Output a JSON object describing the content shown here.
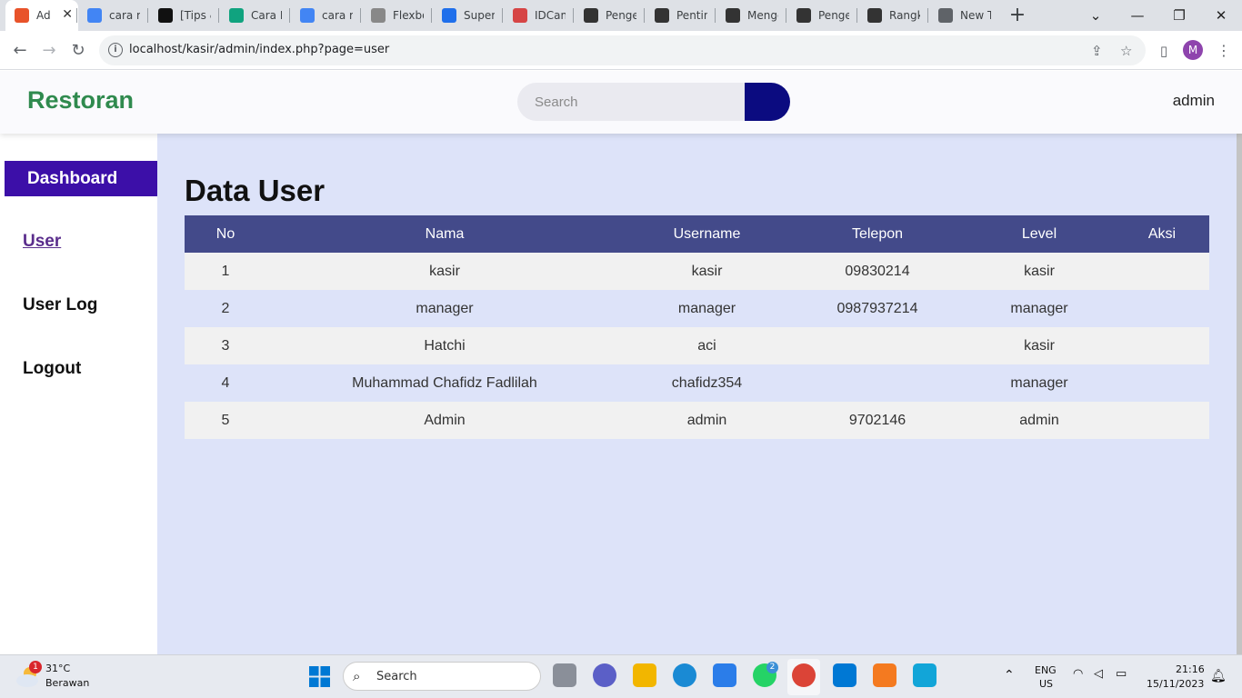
{
  "browser": {
    "tabs": [
      {
        "label": "Ad",
        "active": true,
        "favicon": "xampp-icon",
        "color": "#e8532a"
      },
      {
        "label": "cara m",
        "favicon": "google-icon",
        "color": "#4285f4"
      },
      {
        "label": "[Tips &",
        "favicon": "medium-icon",
        "color": "#111111"
      },
      {
        "label": "Cara M",
        "favicon": "chatgpt-icon",
        "color": "#10a37f"
      },
      {
        "label": "cara m",
        "favicon": "google-icon",
        "color": "#4285f4"
      },
      {
        "label": "Flexbo",
        "favicon": "css-tricks-icon",
        "color": "#888888"
      },
      {
        "label": "Super s",
        "favicon": "code-icon",
        "color": "#1f6feb"
      },
      {
        "label": "IDCam",
        "favicon": "idcamp-icon",
        "color": "#d64545"
      },
      {
        "label": "Penger",
        "favicon": "g-icon",
        "color": "#333333"
      },
      {
        "label": "Penting",
        "favicon": "g-icon",
        "color": "#333333"
      },
      {
        "label": "Menge",
        "favicon": "g-icon",
        "color": "#333333"
      },
      {
        "label": "Penger",
        "favicon": "g-icon",
        "color": "#333333"
      },
      {
        "label": "Rangki",
        "favicon": "g-icon",
        "color": "#333333"
      },
      {
        "label": "New Ta",
        "favicon": "chrome-icon",
        "color": "#5f6368"
      }
    ],
    "url": "localhost/kasir/admin/index.php?page=user",
    "profile_initial": "M"
  },
  "header": {
    "brand": "Restoran",
    "search_placeholder": "Search",
    "user": "admin"
  },
  "sidebar": {
    "dashboard": "Dashboard",
    "items": [
      {
        "label": "User",
        "active": true
      },
      {
        "label": "User Log",
        "active": false
      },
      {
        "label": "Logout",
        "active": false
      }
    ]
  },
  "main": {
    "title": "Data User",
    "columns": [
      "No",
      "Nama",
      "Username",
      "Telepon",
      "Level",
      "Aksi"
    ],
    "rows": [
      [
        "1",
        "kasir",
        "kasir",
        "09830214",
        "kasir",
        ""
      ],
      [
        "2",
        "manager",
        "manager",
        "0987937214",
        "manager",
        ""
      ],
      [
        "3",
        "Hatchi",
        "aci",
        "",
        "kasir",
        ""
      ],
      [
        "4",
        "Muhammad Chafidz Fadlilah",
        "chafidz354",
        "",
        "manager",
        ""
      ],
      [
        "5",
        "Admin",
        "admin",
        "9702146",
        "admin",
        ""
      ]
    ]
  },
  "taskbar": {
    "weather_temp": "31°C",
    "weather_desc": "Berawan",
    "weather_badge": "1",
    "search_label": "Search",
    "whatsapp_badge": "2",
    "lang": "ENG",
    "region": "US",
    "time": "21:16",
    "date": "15/11/2023"
  }
}
